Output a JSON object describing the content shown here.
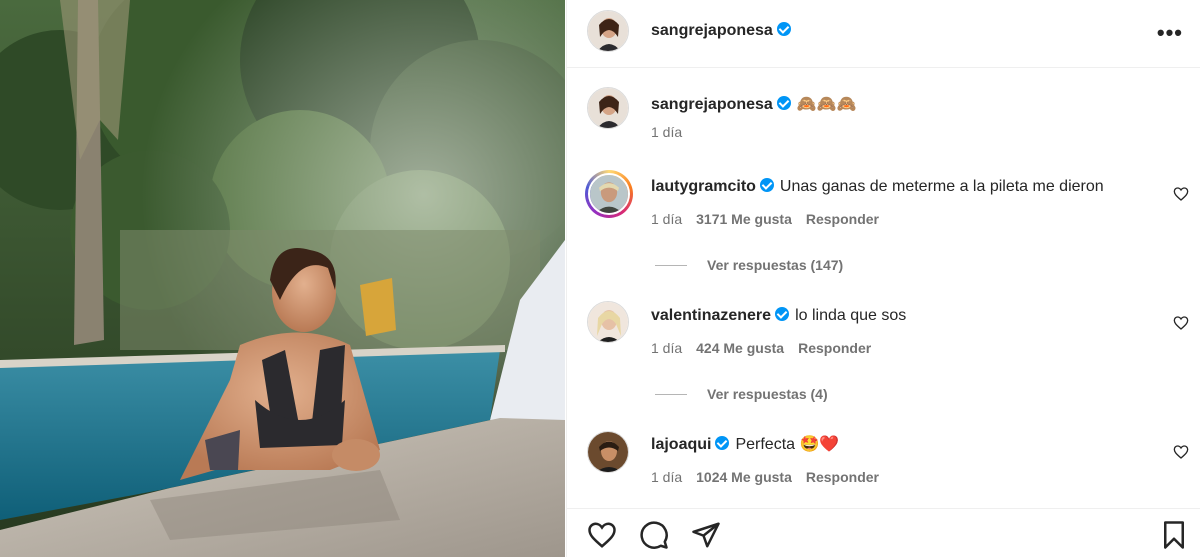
{
  "post": {
    "author": "sangrejaponesa",
    "caption": "🙈🙈🙈",
    "time": "1 día"
  },
  "header": {
    "username": "sangrejaponesa",
    "more_label": "•••"
  },
  "comments": [
    {
      "username": "lautygramcito",
      "text": "Unas ganas de meterme a la pileta me dieron",
      "time": "1 día",
      "likes": "3171 Me gusta",
      "reply": "Responder",
      "view_replies": "Ver respuestas (147)"
    },
    {
      "username": "valentinazenere",
      "text": "lo linda que sos",
      "time": "1 día",
      "likes": "424 Me gusta",
      "reply": "Responder",
      "view_replies": "Ver respuestas (4)"
    },
    {
      "username": "lajoaqui",
      "text": "Perfecta 🤩❤️",
      "time": "1 día",
      "likes": "1024 Me gusta",
      "reply": "Responder"
    }
  ],
  "icons": {
    "verified": "verified-badge-icon",
    "like": "heart-icon",
    "comment": "comment-icon",
    "share": "send-icon",
    "save": "bookmark-icon",
    "more": "more-options-icon"
  },
  "colors": {
    "verified": "#0095f6",
    "text": "#262626",
    "secondary": "#737373",
    "divider": "#efefef"
  }
}
